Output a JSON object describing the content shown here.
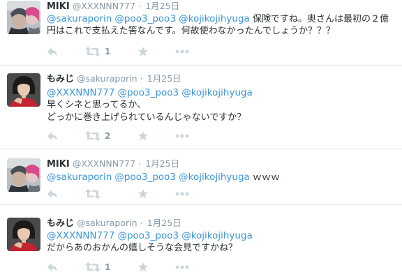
{
  "tweets": [
    {
      "author": "MIKI",
      "handle": "@XXXNNN777",
      "date": "1月25日",
      "mentions": [
        "@sakuraporin",
        "@poo3_poo3",
        "@kojikojihyuga"
      ],
      "lines": [
        "保険ですね。奥さんは最初の２億",
        "円はこれで支払えた筈なんです。何故使わなかったんでしょうか？？？"
      ],
      "retweet_count": "1",
      "avatar": "miki"
    },
    {
      "author": "もみじ",
      "handle": "@sakuraporin",
      "date": "1月25日",
      "mentions": [
        "@XXXNNN777",
        "@poo3_poo3",
        "@kojikojihyuga"
      ],
      "lines": [
        "早くシネと思ってるか、",
        "どっかに巻き上げられているんじゃないですか？"
      ],
      "retweet_count": "2",
      "avatar": "momiji"
    },
    {
      "author": "MIKI",
      "handle": "@XXXNNN777",
      "date": "1月25日",
      "mentions": [
        "@sakuraporin",
        "@poo3_poo3",
        "@kojikojihyuga"
      ],
      "lines": [
        "ｗｗｗ"
      ],
      "retweet_count": "",
      "avatar": "miki"
    },
    {
      "author": "もみじ",
      "handle": "@sakuraporin",
      "date": "1月25日",
      "mentions": [
        "@XXXNNN777",
        "@poo3_poo3",
        "@kojikojihyuga"
      ],
      "lines": [
        "だからあのおかんの嬉しそうな会見ですかね？"
      ],
      "retweet_count": "1",
      "avatar": "momiji"
    }
  ],
  "separator": "·",
  "colors": {
    "link": "#3b94d9",
    "muted": "#8899a6",
    "icon": "#ccd6dd",
    "separator": "#e1e8ed"
  },
  "icons": [
    "reply-icon",
    "retweet-icon",
    "favorite-icon",
    "more-icon"
  ]
}
